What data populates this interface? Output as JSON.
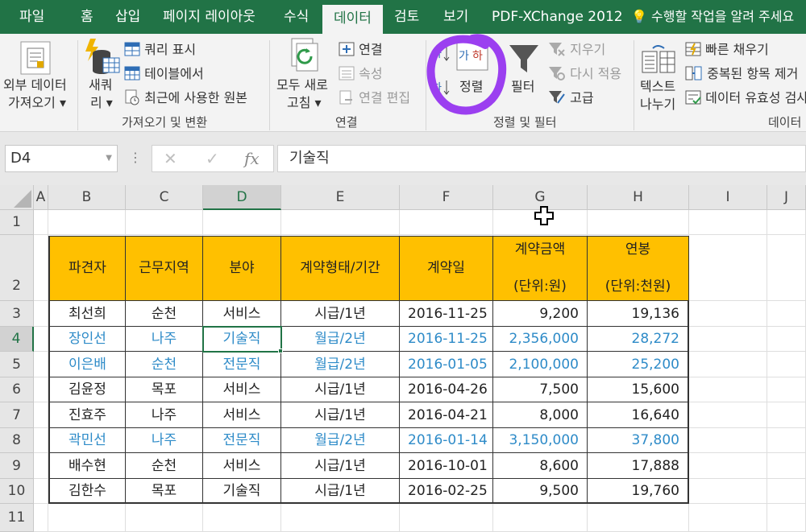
{
  "tabs": [
    "파일",
    "홈",
    "삽입",
    "페이지 레이아웃",
    "수식",
    "데이터",
    "검토",
    "보기",
    "PDF-XChange 2012"
  ],
  "active_tab": "데이터",
  "tell_me": "수행할 작업을 알려 주세요",
  "ribbon": {
    "get_external": [
      "외부 데이터",
      "가져오기 ▾"
    ],
    "new_query": [
      "새쿼",
      "리 ▾"
    ],
    "show_query": "쿼리 표시",
    "from_table": "테이블에서",
    "recent_sources": "최근에 사용한 원본",
    "group_get_transform": "가져오기 및 변환",
    "refresh_all": [
      "모두 새로",
      "고침 ▾"
    ],
    "connections": "연결",
    "properties": "속성",
    "edit_links": "연결 편집",
    "group_connections": "연결",
    "sort": "정렬",
    "filter": "필터",
    "clear": "지우기",
    "reapply": "다시 적용",
    "advanced": "고급",
    "group_sort_filter": "정렬 및 필터",
    "text_to_columns": [
      "텍스트",
      "나누기"
    ],
    "flash_fill": "빠른 채우기",
    "remove_duplicates": "중복된 항목 제거",
    "data_validation": "데이터 유효성 검사",
    "group_data_tools": "데이터"
  },
  "colors": {
    "excel_green": "#217346",
    "header_fill": "#ffc000",
    "highlight_text": "#2e8bc8",
    "annotation": "#9b3ff0"
  },
  "formula_bar": {
    "name_box": "D4",
    "formula": "기술직"
  },
  "columns": [
    "A",
    "B",
    "C",
    "D",
    "E",
    "F",
    "G",
    "H",
    "I",
    "J"
  ],
  "rows": [
    "1",
    "2",
    "3",
    "4",
    "5",
    "6",
    "7",
    "8",
    "9",
    "10",
    "11"
  ],
  "selected_cell": "D4",
  "table": {
    "headers": [
      "파견자",
      "근무지역",
      "분야",
      "계약형태/기간",
      "계약일",
      "계약금액\n(단위:원)",
      "연봉\n(단위:천원)"
    ],
    "rows": [
      {
        "cells": [
          "최선희",
          "순천",
          "서비스",
          "시급/1년",
          "2016-11-25",
          "9,200",
          "19,136"
        ],
        "highlight": false
      },
      {
        "cells": [
          "장인선",
          "나주",
          "기술직",
          "월급/2년",
          "2016-11-25",
          "2,356,000",
          "28,272"
        ],
        "highlight": true
      },
      {
        "cells": [
          "이은배",
          "순천",
          "전문직",
          "월급/2년",
          "2016-01-05",
          "2,100,000",
          "25,200"
        ],
        "highlight": true
      },
      {
        "cells": [
          "김윤정",
          "목포",
          "서비스",
          "시급/1년",
          "2016-04-26",
          "7,500",
          "15,600"
        ],
        "highlight": false
      },
      {
        "cells": [
          "진효주",
          "나주",
          "서비스",
          "시급/1년",
          "2016-04-21",
          "8,000",
          "16,640"
        ],
        "highlight": false
      },
      {
        "cells": [
          "곽민선",
          "나주",
          "전문직",
          "월급/2년",
          "2016-01-14",
          "3,150,000",
          "37,800"
        ],
        "highlight": true
      },
      {
        "cells": [
          "배수현",
          "순천",
          "서비스",
          "시급/1년",
          "2016-10-01",
          "8,600",
          "17,888"
        ],
        "highlight": false
      },
      {
        "cells": [
          "김한수",
          "목포",
          "기술직",
          "시급/1년",
          "2016-02-25",
          "9,500",
          "19,760"
        ],
        "highlight": false
      }
    ]
  }
}
